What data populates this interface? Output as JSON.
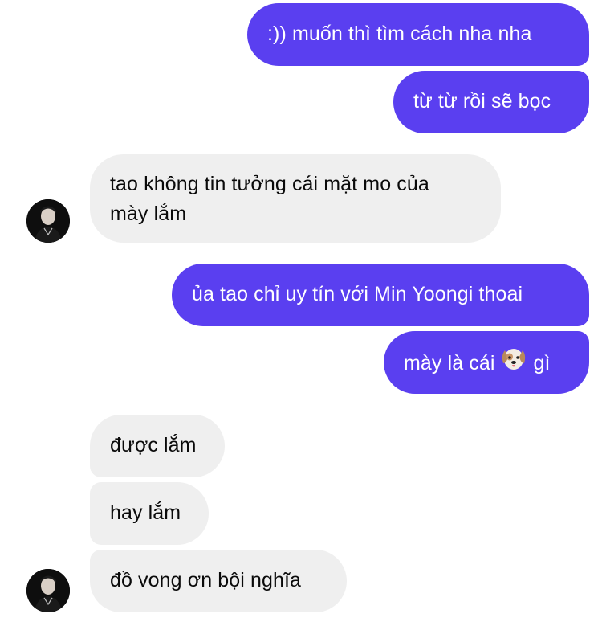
{
  "colors": {
    "outgoing_bubble": "#5a3ff0",
    "incoming_bubble": "#efefef",
    "outgoing_text": "#ffffff",
    "incoming_text": "#0a0a0a"
  },
  "messages": [
    {
      "side": "outgoing",
      "text": ":)) muốn thì tìm cách nha nha"
    },
    {
      "side": "outgoing",
      "text": "từ từ rồi sẽ bọc"
    },
    {
      "side": "incoming",
      "line1": "tao không tin tưởng cái mặt mo của",
      "line2": "mày lắm"
    },
    {
      "side": "outgoing",
      "text": "ủa tao chỉ uy tín với Min Yoongi thoai"
    },
    {
      "side": "outgoing",
      "before": "mày là cái",
      "emoji": "dog-face-emoji",
      "after": "gì"
    },
    {
      "side": "incoming",
      "text": "được lắm"
    },
    {
      "side": "incoming",
      "text": "hay lắm"
    },
    {
      "side": "incoming",
      "text": "đồ vong ơn bội nghĩa"
    }
  ],
  "avatar": {
    "icon": "contact-avatar"
  }
}
